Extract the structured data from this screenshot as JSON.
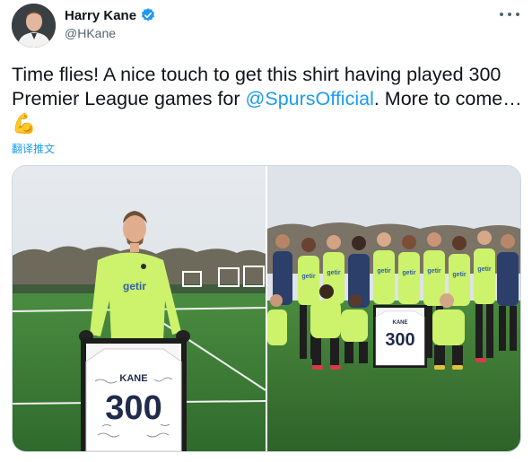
{
  "author": {
    "name": "Harry Kane",
    "handle": "@HKane",
    "avatar_icon": "avatar-photo",
    "verified_icon": "verified-badge-icon"
  },
  "tweet": {
    "text_before": "Time flies! A nice touch to get this shirt having played 300 Premier League games for ",
    "mention": "@SpursOfficial",
    "text_after": ". More to come… ",
    "emoji": "💪",
    "translate_label": "翻译推文"
  },
  "media": {
    "left_photo": {
      "shirt_name": "KANE",
      "shirt_number": "300",
      "sponsor": "getir"
    },
    "right_photo": {
      "shirt_name": "KANE",
      "shirt_number": "300",
      "sponsor": "getir"
    }
  },
  "colors": {
    "link": "#1d9bf0",
    "secondary_text": "#536471",
    "kit": "#cdf26b",
    "grass": "#3f7e3a",
    "sky": "#dfe5ea"
  }
}
